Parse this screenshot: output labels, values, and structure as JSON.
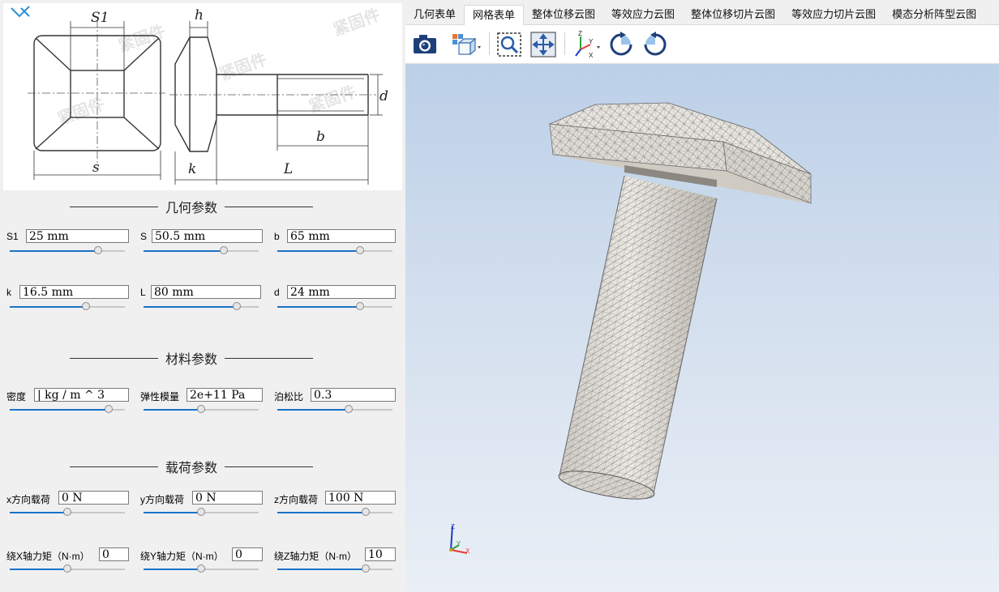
{
  "drawing": {
    "labels": {
      "s1": "S1",
      "s": "s",
      "h": "h",
      "k": "k",
      "L": "L",
      "d": "d",
      "b": "b"
    },
    "watermark": "紧固件"
  },
  "geometry": {
    "title": "几何参数",
    "params": [
      {
        "label": "S1",
        "value": "25 mm",
        "slider": 0.77
      },
      {
        "label": "S",
        "value": "50.5 mm",
        "slider": 0.7
      },
      {
        "label": "b",
        "value": "65 mm",
        "slider": 0.72
      },
      {
        "label": "k",
        "value": "16.5 mm",
        "slider": 0.66
      },
      {
        "label": "L",
        "value": "80 mm",
        "slider": 0.81
      },
      {
        "label": "d",
        "value": "24 mm",
        "slider": 0.72
      }
    ]
  },
  "material": {
    "title": "材料参数",
    "params": [
      {
        "label": "密度",
        "value": "| kg / m ^ 3",
        "slider": 0.86
      },
      {
        "label": "弹性模量",
        "value": "2e+11 Pa",
        "slider": 0.5
      },
      {
        "label": "泊松比",
        "value": "0.3",
        "slider": 0.62
      }
    ]
  },
  "load": {
    "title": "载荷参数",
    "params": [
      {
        "label": "x方向载荷",
        "value": "0 N",
        "slider": 0.5
      },
      {
        "label": "y方向载荷",
        "value": "0 N",
        "slider": 0.5
      },
      {
        "label": "z方向载荷",
        "value": "100 N",
        "slider": 0.77
      },
      {
        "label": "绕X轴力矩（N·m）",
        "value": "0",
        "slider": 0.5
      },
      {
        "label": "绕Y轴力矩（N·m）",
        "value": "0",
        "slider": 0.5
      },
      {
        "label": "绕Z轴力矩（N·m）",
        "value": "10",
        "slider": 0.77
      }
    ]
  },
  "tabs": [
    "几何表单",
    "网格表单",
    "整体位移云图",
    "等效应力云图",
    "整体位移切片云图",
    "等效应力切片云图",
    "模态分析阵型云图"
  ],
  "active_tab": 1,
  "toolbar": {
    "buttons": [
      "camera-icon",
      "view-cube-icon",
      "zoom-fit-icon",
      "pan-icon",
      "axes-view-icon",
      "rotate-cw-icon",
      "rotate-ccw-icon"
    ],
    "axis_labels": {
      "x": "X",
      "y": "Y",
      "z": "Z"
    }
  },
  "colors": {
    "slider_fill": "#1a73c8",
    "viewport_top": "#bcd0e8",
    "viewport_bottom": "#eaeff6",
    "mesh_line": "#7d7d7d",
    "mesh_face": "#e4e1db",
    "triad_x": "#e53935",
    "triad_y": "#2e9e3e",
    "triad_z": "#1e3cc8"
  }
}
